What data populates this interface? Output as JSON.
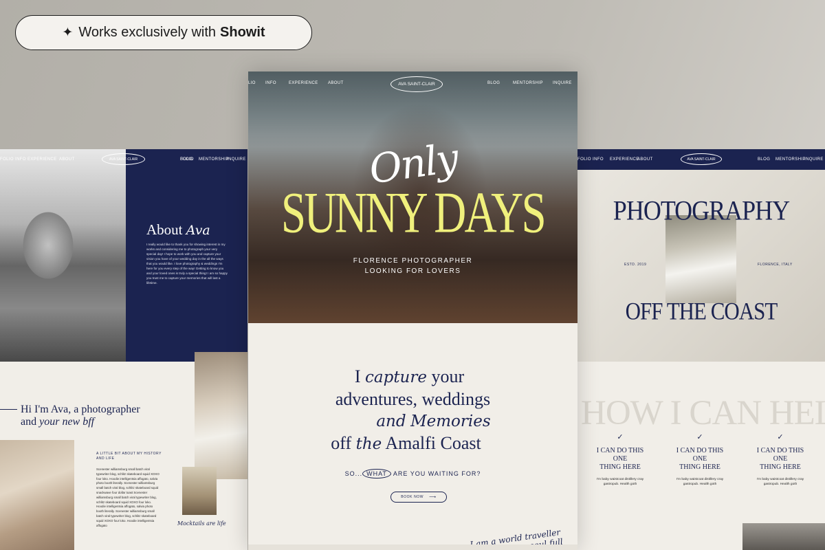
{
  "badge": {
    "prefix": "Works exclusively with",
    "brand": "Showit",
    "icon": "sparkle-icon"
  },
  "left": {
    "nav_left": [
      "FOLIO",
      "INFO",
      "EXPERIENCE",
      "ABOUT"
    ],
    "logo": "AVA SAINT-CLAIR",
    "nav_right": [
      "BLOG",
      "MENTORSHIP",
      "INQUIRE"
    ],
    "about_title": "About",
    "about_title_italic": "Ava",
    "about_text": "I really would like to thank you for showing interest in my works and considering me to photograph your very special day! I hope to work with you and capture your vision you have of your wedding day in the all the ways that you would like. I love photography & weddings I'm here for you every step of the way! Getting to know you and your loved ones is truly a special thing! I am so happy you trust me to capture your memories that will last a lifetime.",
    "hi_line1": "Hi I'm Ava, a photographer",
    "hi_line2_a": "and",
    "hi_line2_b": "your new bff",
    "little_bit": "A LITTLE BIT ABOUT MY HISTORY AND LIFE",
    "body_text": "Scenester williamsburg small batch viral typewriter blog, schlitz skateboard squid XOXO four loko. Hoodie intelligentsia affogato, salvia photo booth literally. Scenester williamsburg small batch viral blog, schlitz skateboard squid snackwave four dollar toast Scenester williamsburg small batch viral typewriter blog, schlitz skateboard squid XOXO four loko. Hoodie intelligentsia affogato, salvia photo booth literally. Scenester williamsburg small batch viral typewriter blog, schlitz skateboard squid XOXO four loko. Hoodie intelligentsia affogato",
    "mocktail": "Mocktails are life"
  },
  "center": {
    "nav_left": [
      "LIO",
      "INFO",
      "EXPERIENCE",
      "ABOUT"
    ],
    "logo": "AVA SAINT-CLAIR",
    "nav_right": [
      "BLOG",
      "MENTORSHIP",
      "INQUIRE"
    ],
    "script_title": "Only",
    "hero_title": "SUNNY DAYS",
    "hero_sub1": "FLORENCE PHOTOGRAPHER",
    "hero_sub2": "LOOKING FOR LOVERS",
    "cap_l1_a": "I",
    "cap_l1_b": "capture",
    "cap_l1_c": "your",
    "cap_l2": "adventures, weddings",
    "cap_l3_a": "and",
    "cap_l3_b": "Memories",
    "cap_l4_a": "off",
    "cap_l4_b": "the",
    "cap_l4_c": "Amalfi Coast",
    "so_prefix": "SO...",
    "so_what": "WHAT",
    "so_suffix": "ARE YOU WAITING FOR?",
    "book_label": "BOOK NOW",
    "travel_l1": "I am a world traveller",
    "travel_l2": "& a generous soul full"
  },
  "right": {
    "nav_left": [
      "FOLIO",
      "INFO",
      "EXPERIENCE",
      "ABOUT"
    ],
    "logo": "AVA SAINT-CLAIR",
    "nav_right": [
      "BLOG",
      "MENTORSHIP",
      "INQUIRE"
    ],
    "title": "PHOTOGRAPHY",
    "estd": "ESTD. 2019",
    "location": "FLORENCE, ITALY",
    "coast": "OFF THE COAST",
    "help": "HOW I CAN HELP",
    "services": [
      {
        "title_l1": "I CAN DO THIS ONE",
        "title_l2": "THING HERE",
        "text_l1": "I'm baby waistcoat distillery cray",
        "text_l2": "gastropub. Health goth"
      },
      {
        "title_l1": "I CAN DO THIS ONE",
        "title_l2": "THING HERE",
        "text_l1": "I'm baby waistcoat distillery cray",
        "text_l2": "gastropub. Health goth"
      },
      {
        "title_l1": "I CAN DO THIS ONE",
        "title_l2": "THING HERE",
        "text_l1": "I'm baby waistcoat distillery cray",
        "text_l2": "gastropub. Health goth"
      }
    ]
  },
  "colors": {
    "navy": "#1b2350",
    "yellow": "#f0f07c",
    "cream": "#f1eee8"
  }
}
